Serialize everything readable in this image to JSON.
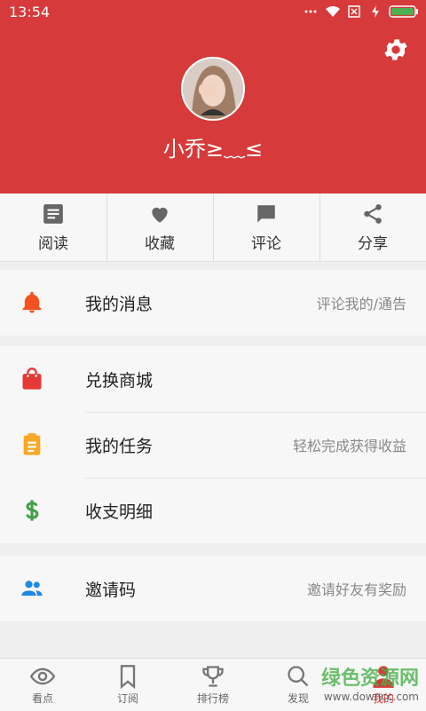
{
  "status": {
    "time": "13:54"
  },
  "profile": {
    "name": "小乔≥﹏≤"
  },
  "quick": [
    {
      "label": "阅读",
      "icon": "article-icon"
    },
    {
      "label": "收藏",
      "icon": "heart-icon"
    },
    {
      "label": "评论",
      "icon": "comment-icon"
    },
    {
      "label": "分享",
      "icon": "share-icon"
    }
  ],
  "menu": {
    "messages": {
      "title": "我的消息",
      "hint": "评论我的/通告",
      "icon": "bell-icon",
      "color": "#f4511e"
    },
    "shop": {
      "title": "兑换商城",
      "hint": "",
      "icon": "shopping-bag-icon",
      "color": "#e53935"
    },
    "tasks": {
      "title": "我的任务",
      "hint": "轻松完成获得收益",
      "icon": "clipboard-icon",
      "color": "#f9a825"
    },
    "finance": {
      "title": "收支明细",
      "hint": "",
      "icon": "dollar-icon",
      "color": "#43a047"
    },
    "invite": {
      "title": "邀请码",
      "hint": "邀请好友有奖励",
      "icon": "people-icon",
      "color": "#1e88e5"
    }
  },
  "tabs": [
    {
      "label": "看点",
      "icon": "eye-icon"
    },
    {
      "label": "订阅",
      "icon": "bookmark-icon"
    },
    {
      "label": "排行榜",
      "icon": "trophy-icon"
    },
    {
      "label": "发现",
      "icon": "search-icon"
    },
    {
      "label": "我的",
      "icon": "person-icon",
      "active": true
    }
  ],
  "watermark": {
    "brand": "绿色资源网",
    "url": "www.downcc.com"
  },
  "colors": {
    "primary": "#d63a3a"
  }
}
